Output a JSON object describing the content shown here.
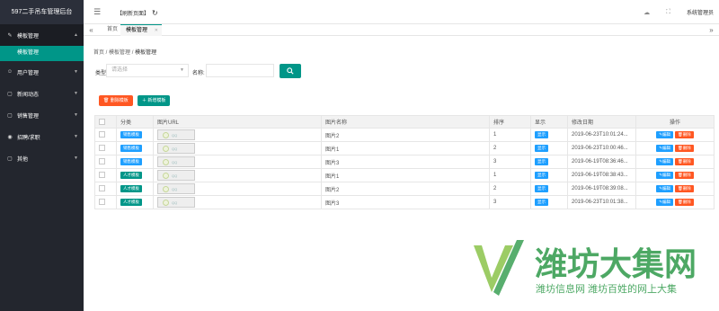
{
  "sidebar": {
    "brand": "597二手吊车管理后台",
    "items": [
      {
        "icon": "edit-icon",
        "glyph": "✎",
        "label": "模板管理",
        "open": true
      },
      {
        "icon": "user-icon",
        "glyph": "☺",
        "label": "用户管理"
      },
      {
        "icon": "doc-icon",
        "glyph": "▢",
        "label": "新闻动态"
      },
      {
        "icon": "doc-icon",
        "glyph": "▢",
        "label": "销售管理"
      },
      {
        "icon": "circle-icon",
        "glyph": "◉",
        "label": "招聘/求职"
      },
      {
        "icon": "doc-icon",
        "glyph": "▢",
        "label": "其他"
      }
    ],
    "active_sub": "模板管理"
  },
  "topbar": {
    "refresh_label": "【刷新页面】",
    "admin_label": "系统管理员"
  },
  "tabs": {
    "home": "首页",
    "active": "模板管理"
  },
  "breadcrumb": {
    "a": "首页",
    "b": "模板管理",
    "c": "模板管理",
    "sep": " / "
  },
  "search": {
    "type_label": "类型",
    "type_placeholder": "请选择",
    "name_label": "名称:"
  },
  "actions": {
    "delete_label": "删除模板",
    "add_label": "新增模板"
  },
  "table": {
    "headers": [
      "分类",
      "图片URL",
      "图片名称",
      "排序",
      "显示",
      "修改日期",
      "操作"
    ],
    "rows": [
      {
        "category": "销售模板",
        "cat_color": "blue",
        "name": "图片2",
        "sort": "1",
        "show": "显示",
        "date": "2019-06-23T10:01:24..."
      },
      {
        "category": "销售模板",
        "cat_color": "blue",
        "name": "图片1",
        "sort": "2",
        "show": "显示",
        "date": "2019-06-23T10:00:46..."
      },
      {
        "category": "销售模板",
        "cat_color": "blue",
        "name": "图片3",
        "sort": "3",
        "show": "显示",
        "date": "2019-06-19T08:36:46..."
      },
      {
        "category": "人才模板",
        "cat_color": "green",
        "name": "图片1",
        "sort": "1",
        "show": "显示",
        "date": "2019-06-19T08:38:43..."
      },
      {
        "category": "人才模板",
        "cat_color": "green",
        "name": "图片2",
        "sort": "2",
        "show": "显示",
        "date": "2019-06-19T08:39:08..."
      },
      {
        "category": "人才模板",
        "cat_color": "green",
        "name": "图片3",
        "sort": "3",
        "show": "显示",
        "date": "2019-06-23T10:01:38..."
      }
    ],
    "thumb_text": "QQ",
    "edit_label": "编辑",
    "delete_label": "删除"
  },
  "watermark": {
    "title": "潍坊大集网",
    "subtitle": "潍坊信息网 潍坊百姓的网上大集"
  },
  "colors": {
    "primary": "#009688",
    "danger": "#ff5722",
    "info": "#1e9fff",
    "sidebar": "#23262e"
  }
}
